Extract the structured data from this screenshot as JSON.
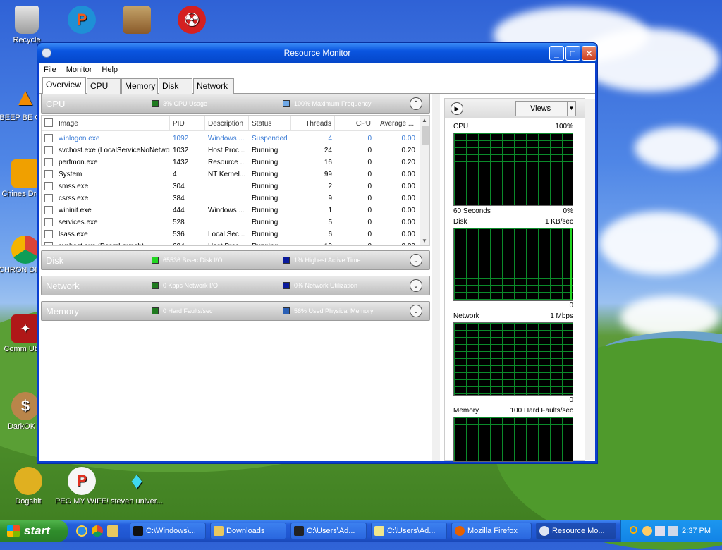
{
  "desktop": {
    "icons": [
      {
        "label": "Recycle"
      },
      {
        "label": "BEEP BE CAR"
      },
      {
        "label": "Chines Droug"
      },
      {
        "label": "CHRON DISEA"
      },
      {
        "label": "Comm Utopi"
      },
      {
        "label": "DarkOK H"
      },
      {
        "label": "Dogshit"
      },
      {
        "label": "PEG MY WIFE!"
      },
      {
        "label": "steven univer..."
      }
    ]
  },
  "window": {
    "title": "Resource Monitor",
    "menu": [
      "File",
      "Monitor",
      "Help"
    ],
    "tabs": [
      "Overview",
      "CPU",
      "Memory",
      "Disk",
      "Network"
    ],
    "controls": {
      "minimize": "_",
      "maximize": "□",
      "close": "✕"
    }
  },
  "cpu_section": {
    "name": "CPU",
    "metric1": "3% CPU Usage",
    "metric2": "100% Maximum Frequency",
    "columns": [
      "Image",
      "PID",
      "Description",
      "Status",
      "Threads",
      "CPU",
      "Average ..."
    ],
    "rows": [
      {
        "image": "winlogon.exe",
        "pid": "1092",
        "description": "Windows ...",
        "status": "Suspended",
        "threads": "4",
        "cpu": "0",
        "avg": "0.00"
      },
      {
        "image": "svchost.exe (LocalServiceNoNetwork)",
        "pid": "1032",
        "description": "Host Proc...",
        "status": "Running",
        "threads": "24",
        "cpu": "0",
        "avg": "0.20"
      },
      {
        "image": "perfmon.exe",
        "pid": "1432",
        "description": "Resource ...",
        "status": "Running",
        "threads": "16",
        "cpu": "0",
        "avg": "0.20"
      },
      {
        "image": "System",
        "pid": "4",
        "description": "NT Kernel...",
        "status": "Running",
        "threads": "99",
        "cpu": "0",
        "avg": "0.00"
      },
      {
        "image": "smss.exe",
        "pid": "304",
        "description": "",
        "status": "Running",
        "threads": "2",
        "cpu": "0",
        "avg": "0.00"
      },
      {
        "image": "csrss.exe",
        "pid": "384",
        "description": "",
        "status": "Running",
        "threads": "9",
        "cpu": "0",
        "avg": "0.00"
      },
      {
        "image": "wininit.exe",
        "pid": "444",
        "description": "Windows ...",
        "status": "Running",
        "threads": "1",
        "cpu": "0",
        "avg": "0.00"
      },
      {
        "image": "services.exe",
        "pid": "528",
        "description": "",
        "status": "Running",
        "threads": "5",
        "cpu": "0",
        "avg": "0.00"
      },
      {
        "image": "lsass.exe",
        "pid": "536",
        "description": "Local Sec...",
        "status": "Running",
        "threads": "6",
        "cpu": "0",
        "avg": "0.00"
      },
      {
        "image": "svchost.exe (DcomLaunch)",
        "pid": "604",
        "description": "Host Proc...",
        "status": "Running",
        "threads": "10",
        "cpu": "0",
        "avg": "0.00"
      }
    ]
  },
  "disk_section": {
    "name": "Disk",
    "metric1": "65536 B/sec Disk I/O",
    "metric2": "1% Highest Active Time"
  },
  "network_section": {
    "name": "Network",
    "metric1": "0 Kbps Network I/O",
    "metric2": "0% Network Utilization"
  },
  "memory_section": {
    "name": "Memory",
    "metric1": "0 Hard Faults/sec",
    "metric2": "56% Used Physical Memory"
  },
  "right_panel": {
    "views_label": "Views",
    "cpu": {
      "label": "CPU",
      "value": "100%",
      "footer_left": "60 Seconds",
      "footer_right": "0%"
    },
    "disk": {
      "label": "Disk",
      "value": "1 KB/sec",
      "footer_right": "0"
    },
    "network": {
      "label": "Network",
      "value": "1 Mbps",
      "footer_right": "0"
    },
    "memory": {
      "label": "Memory",
      "value": "100 Hard Faults/sec"
    }
  },
  "taskbar": {
    "start_label": "start",
    "buttons": [
      {
        "label": "C:\\Windows\\..."
      },
      {
        "label": "Downloads"
      },
      {
        "label": "C:\\Users\\Ad..."
      },
      {
        "label": "C:\\Users\\Ad..."
      },
      {
        "label": "Mozilla Firefox"
      },
      {
        "label": "Resource Mo..."
      }
    ],
    "clock": "2:37 PM"
  },
  "colors": {
    "cpu_metric1": "#1f7a1f",
    "cpu_metric2": "#6fa8e6",
    "disk_metric1": "#22d622",
    "disk_metric2": "#0a1a9c",
    "network_metric1": "#1f7a1f",
    "network_metric2": "#0a1a9c",
    "memory_metric1": "#1f7a1f",
    "memory_metric2": "#2a5fb5"
  }
}
